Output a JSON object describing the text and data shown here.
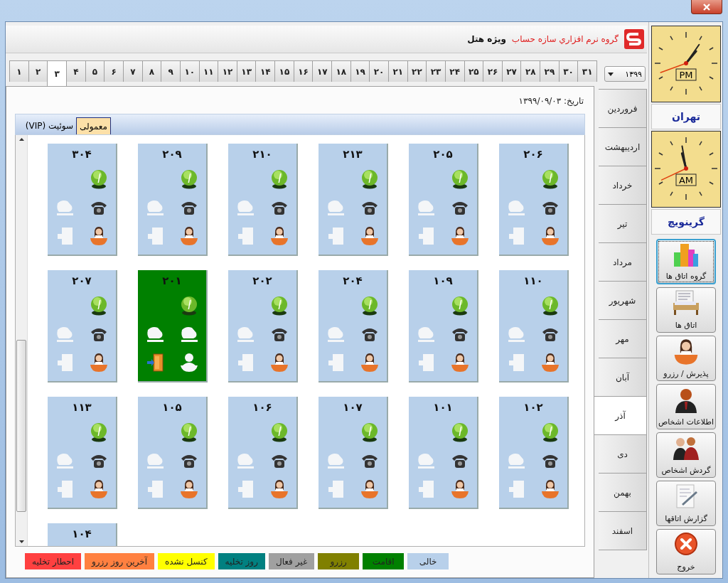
{
  "header": {
    "company": "گروه نرم افزاري سازه حساب",
    "edition": "ویژه هتل"
  },
  "days": [
    {
      "label": "۳۱",
      "selected": false
    },
    {
      "label": "۳۰",
      "selected": false
    },
    {
      "label": "۲۹",
      "selected": false
    },
    {
      "label": "۲۸",
      "selected": false
    },
    {
      "label": "۲۷",
      "selected": false
    },
    {
      "label": "۲۶",
      "selected": false
    },
    {
      "label": "۲۵",
      "selected": false
    },
    {
      "label": "۲۴",
      "selected": false
    },
    {
      "label": "۲۳",
      "selected": false
    },
    {
      "label": "۲۲",
      "selected": false
    },
    {
      "label": "۲۱",
      "selected": false
    },
    {
      "label": "۲۰",
      "selected": false
    },
    {
      "label": "۱۹",
      "selected": false
    },
    {
      "label": "۱۸",
      "selected": false
    },
    {
      "label": "۱۷",
      "selected": false
    },
    {
      "label": "۱۶",
      "selected": false
    },
    {
      "label": "۱۵",
      "selected": false
    },
    {
      "label": "۱۴",
      "selected": false
    },
    {
      "label": "۱۳",
      "selected": false
    },
    {
      "label": "۱۲",
      "selected": false
    },
    {
      "label": "۱۱",
      "selected": false
    },
    {
      "label": "۱۰",
      "selected": false
    },
    {
      "label": "۹",
      "selected": false
    },
    {
      "label": "۸",
      "selected": false
    },
    {
      "label": "۷",
      "selected": false
    },
    {
      "label": "۶",
      "selected": false
    },
    {
      "label": "۵",
      "selected": false
    },
    {
      "label": "۴",
      "selected": false
    },
    {
      "label": "۳",
      "selected": true
    },
    {
      "label": "۲",
      "selected": false
    },
    {
      "label": "۱",
      "selected": false
    }
  ],
  "year": {
    "value": "۱۳۹۹"
  },
  "date": "تاریخ: ۱۳۹۹/۰۹/۰۳",
  "room_tabs": [
    {
      "label": "معمولی",
      "selected": true
    },
    {
      "label": "سوئیت (VIP)",
      "selected": false
    }
  ],
  "room_rows": [
    [
      {
        "number": "۲۰۶",
        "kind": "vacant",
        "color": "#b8d0ea"
      },
      {
        "number": "۲۰۵",
        "kind": "vacant",
        "color": "#b8d0ea"
      },
      {
        "number": "۲۱۳",
        "kind": "vacant",
        "color": "#b8d0ea"
      },
      {
        "number": "۲۱۰",
        "kind": "vacant",
        "color": "#b8d0ea"
      },
      {
        "number": "۲۰۹",
        "kind": "vacant",
        "color": "#b8d0ea"
      },
      {
        "number": "۳۰۴",
        "kind": "vacant",
        "color": "#b8d0ea"
      }
    ],
    [
      {
        "number": "۱۱۰",
        "kind": "vacant",
        "color": "#b8d0ea"
      },
      {
        "number": "۱۰۹",
        "kind": "vacant",
        "color": "#b8d0ea"
      },
      {
        "number": "۲۰۴",
        "kind": "vacant",
        "color": "#b8d0ea"
      },
      {
        "number": "۲۰۲",
        "kind": "vacant",
        "color": "#b8d0ea"
      },
      {
        "number": "۲۰۱",
        "kind": "occupied",
        "color": "#008000"
      },
      {
        "number": "۲۰۷",
        "kind": "vacant",
        "color": "#b8d0ea"
      }
    ],
    [
      {
        "number": "۱۰۲",
        "kind": "vacant",
        "color": "#b8d0ea"
      },
      {
        "number": "۱۰۱",
        "kind": "vacant",
        "color": "#b8d0ea"
      },
      {
        "number": "۱۰۷",
        "kind": "vacant",
        "color": "#b8d0ea"
      },
      {
        "number": "۱۰۶",
        "kind": "vacant",
        "color": "#b8d0ea"
      },
      {
        "number": "۱۰۵",
        "kind": "vacant",
        "color": "#b8d0ea"
      },
      {
        "number": "۱۱۳",
        "kind": "vacant",
        "color": "#b8d0ea"
      }
    ],
    [
      {
        "number": "۱۰۴",
        "kind": "vacant",
        "color": "#b8d0ea"
      }
    ]
  ],
  "legend": [
    {
      "label": "خالی",
      "color": "#b8d0ea"
    },
    {
      "label": "اقامت",
      "color": "#008000"
    },
    {
      "label": "رزرو",
      "color": "#808000"
    },
    {
      "label": "غیر فعال",
      "color": "#a0a0a0"
    },
    {
      "label": "روز تخلیه",
      "color": "#008080"
    },
    {
      "label": "کنسل نشده",
      "color": "#ffff00"
    },
    {
      "label": "آخرین روز رزرو",
      "color": "#ff8040"
    },
    {
      "label": "احطار تخلیه",
      "color": "#ff4040"
    }
  ],
  "months": [
    {
      "label": "فروردین",
      "selected": false
    },
    {
      "label": "اردیبهشت",
      "selected": false
    },
    {
      "label": "خرداد",
      "selected": false
    },
    {
      "label": "تیر",
      "selected": false
    },
    {
      "label": "مرداد",
      "selected": false
    },
    {
      "label": "شهریور",
      "selected": false
    },
    {
      "label": "مهر",
      "selected": false
    },
    {
      "label": "آبان",
      "selected": false
    },
    {
      "label": "آذر",
      "selected": true
    },
    {
      "label": "دی",
      "selected": false
    },
    {
      "label": "بهمن",
      "selected": false
    },
    {
      "label": "اسفند",
      "selected": false
    }
  ],
  "clocks": [
    {
      "period": "PM",
      "city": "تهران"
    },
    {
      "period": "AM",
      "city": "گرینویچ"
    }
  ],
  "buttons": [
    {
      "label": "گروه اتاق ها",
      "kind": "buildings",
      "selected": true
    },
    {
      "label": "اتاق ها",
      "kind": "rooms",
      "selected": false
    },
    {
      "label": "پذیرش / رزرو",
      "kind": "reception",
      "selected": false
    },
    {
      "label": "اطلاعات اشخاص",
      "kind": "person",
      "selected": false
    },
    {
      "label": "گردش اشخاص",
      "kind": "people",
      "selected": false
    },
    {
      "label": "گزارش اتاقها",
      "kind": "report",
      "selected": false
    },
    {
      "label": "خروج",
      "kind": "exit",
      "selected": false
    }
  ]
}
